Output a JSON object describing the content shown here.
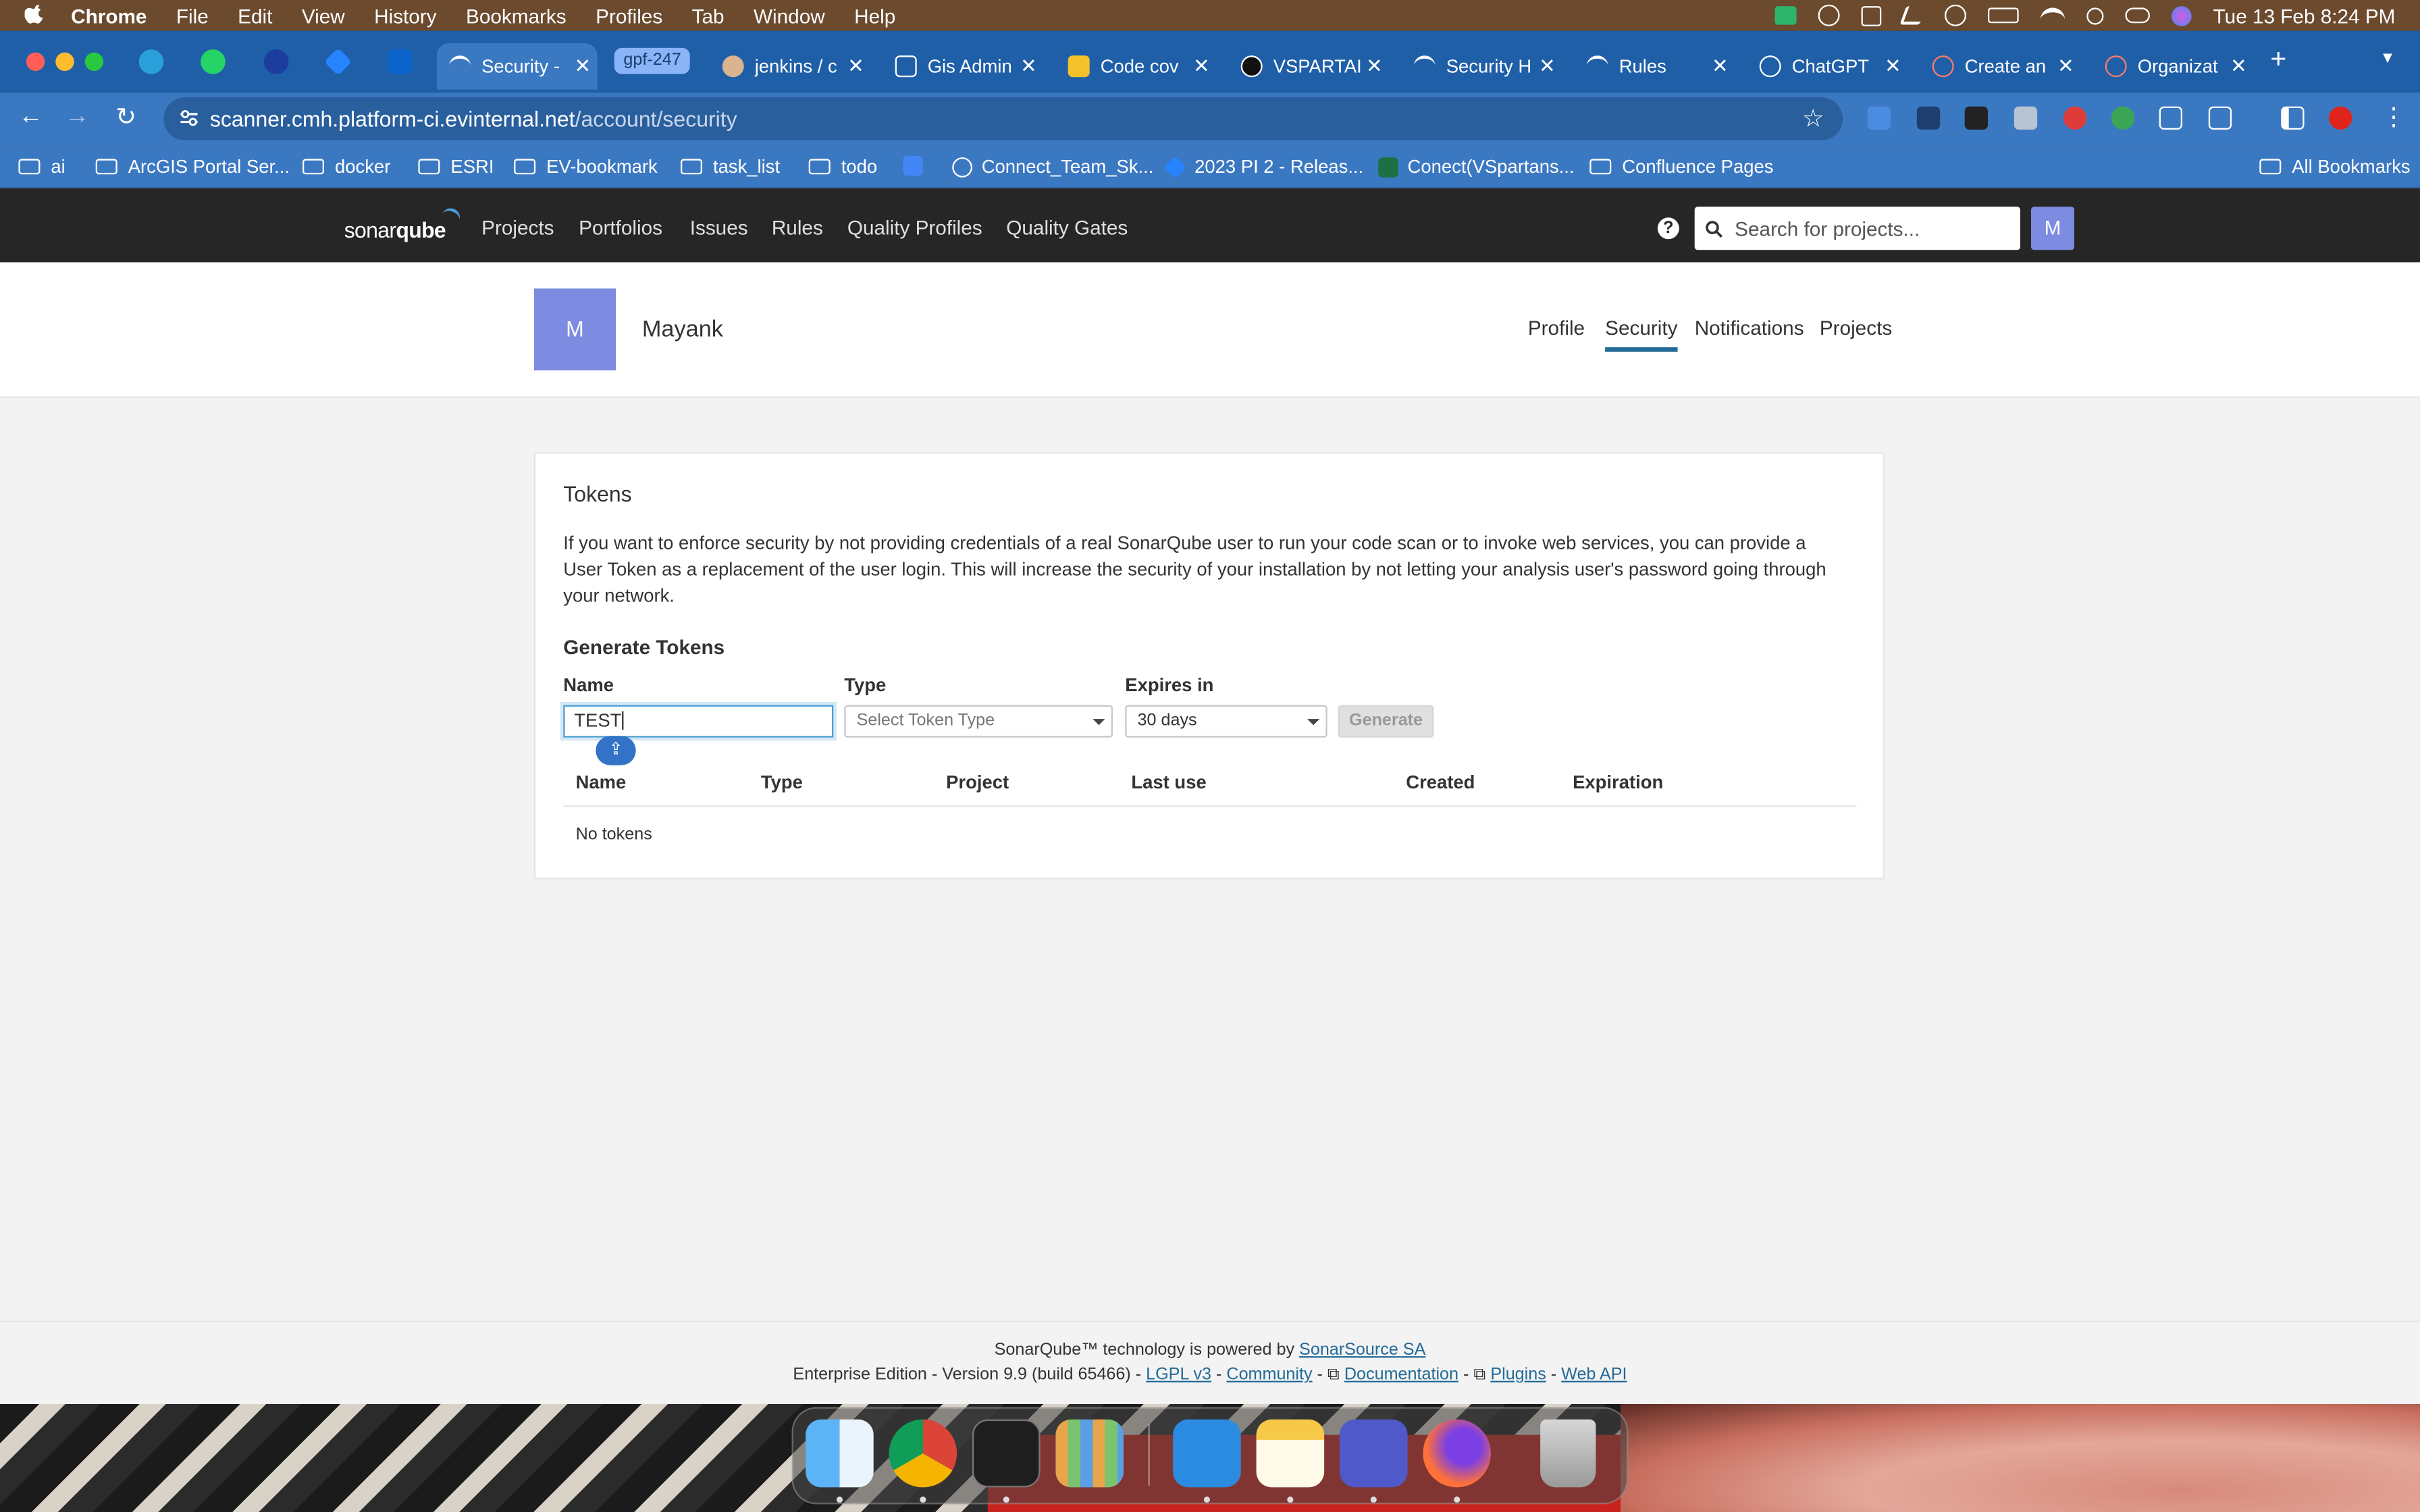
{
  "menubar": {
    "app": "Chrome",
    "items": [
      "File",
      "Edit",
      "View",
      "History",
      "Bookmarks",
      "Profiles",
      "Tab",
      "Window",
      "Help"
    ],
    "datetime": "Tue 13 Feb  8:24 PM"
  },
  "tabs": [
    {
      "label": "Security -",
      "active": true
    },
    {
      "label": "gpf-247",
      "group": true
    },
    {
      "label": "jenkins / c"
    },
    {
      "label": "Gis Admin"
    },
    {
      "label": "Code cov"
    },
    {
      "label": "VSPARTAI"
    },
    {
      "label": "Security H"
    },
    {
      "label": "Rules"
    },
    {
      "label": "ChatGPT"
    },
    {
      "label": "Create an"
    },
    {
      "label": "Organizat"
    }
  ],
  "omnibox": {
    "host": "scanner.cmh.platform-ci.evinternal.net",
    "path": "/account/security"
  },
  "bookmarks": [
    "ai",
    "ArcGIS Portal Ser...",
    "docker",
    "ESRI",
    "EV-bookmark",
    "task_list",
    "todo",
    "Connect_Team_Sk...",
    "2023 PI 2 - Releas...",
    "Conect(VSpartans...",
    "Confluence Pages"
  ],
  "all_bookmarks": "All Bookmarks",
  "sonar": {
    "logo_plain": "sonar",
    "logo_bold": "qube",
    "nav": [
      "Projects",
      "Portfolios",
      "Issues",
      "Rules",
      "Quality Profiles",
      "Quality Gates"
    ],
    "help": "?",
    "search_placeholder": "Search for projects...",
    "avatar": "M"
  },
  "account": {
    "avatar": "M",
    "name": "Mayank",
    "tabs": [
      "Profile",
      "Security",
      "Notifications",
      "Projects"
    ],
    "active_tab": "Security"
  },
  "tokens": {
    "title": "Tokens",
    "description": "If you want to enforce security by not providing credentials of a real SonarQube user to run your code scan or to invoke web services, you can provide a User Token as a replacement of the user login. This will increase the security of your installation by not letting your analysis user's password going through your network.",
    "generate_title": "Generate Tokens",
    "name_label": "Name",
    "type_label": "Type",
    "expires_label": "Expires in",
    "name_value": "TEST",
    "type_placeholder": "Select Token Type",
    "expires_value": "30 days",
    "generate_button": "Generate",
    "columns": [
      "Name",
      "Type",
      "Project",
      "Last use",
      "Created",
      "Expiration"
    ],
    "empty_text": "No tokens"
  },
  "footer": {
    "powered_prefix": "SonarQube™ technology is powered by ",
    "powered_link": "SonarSource SA",
    "edition": "Enterprise Edition - Version 9.9 (build 65466) - ",
    "links": [
      "LGPL v3",
      "Community",
      "Documentation",
      "Plugins",
      "Web API"
    ]
  },
  "colors": {
    "sonar_header": "#262626",
    "chrome_blue": "#3b78c2",
    "avatar": "#7d8ce0",
    "link": "#236a97"
  }
}
